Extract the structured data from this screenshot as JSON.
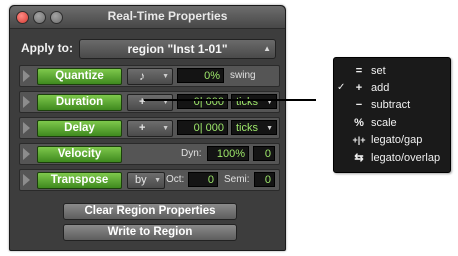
{
  "window": {
    "title": "Real-Time Properties"
  },
  "apply_to": {
    "label": "Apply to:",
    "value": "region \"Inst 1-01\""
  },
  "rows": {
    "quantize": {
      "label": "Quantize",
      "note_icon": "note-icon",
      "value": "0%",
      "suffix": "swing"
    },
    "duration": {
      "label": "Duration",
      "operator": "+",
      "value": "0| 000",
      "unit": "ticks"
    },
    "delay": {
      "label": "Delay",
      "operator": "+",
      "value": "0| 000",
      "unit": "ticks"
    },
    "velocity": {
      "label": "Velocity",
      "dyn_label": "Dyn:",
      "dyn_value": "100%",
      "offset_value": "0"
    },
    "transpose": {
      "label": "Transpose",
      "mode": "by",
      "oct_label": "Oct:",
      "oct_value": "0",
      "semi_label": "Semi:",
      "semi_value": "0"
    }
  },
  "buttons": {
    "clear": "Clear Region Properties",
    "write": "Write to Region"
  },
  "menu": {
    "checked_item": "add",
    "items": [
      {
        "icon": "=",
        "label": "set",
        "checked": false
      },
      {
        "icon": "+",
        "label": "add",
        "checked": true,
        "checkmark": "✓"
      },
      {
        "icon": "−",
        "label": "subtract",
        "checked": false
      },
      {
        "icon": "%",
        "label": "scale",
        "checked": false
      },
      {
        "icon": "+|+",
        "label": "legato/gap",
        "checked": false
      },
      {
        "icon": "⇆",
        "label": "legato/overlap",
        "checked": false
      }
    ]
  },
  "colors": {
    "accent_green": "#5aa82f",
    "field_text": "#9ee86a",
    "panel": "#3d3d3d"
  }
}
